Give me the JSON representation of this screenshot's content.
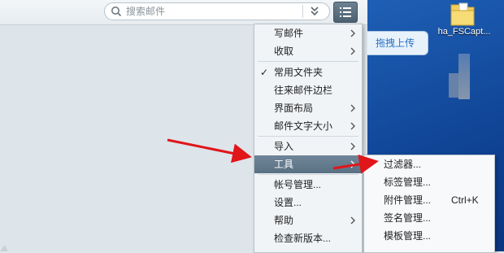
{
  "search": {
    "placeholder": "搜索邮件"
  },
  "menu": {
    "items": [
      {
        "label": "写邮件",
        "submenu": true,
        "checked": false,
        "active": false
      },
      {
        "label": "收取",
        "submenu": true,
        "checked": false,
        "active": false
      },
      {
        "label": "常用文件夹",
        "submenu": false,
        "checked": true,
        "active": false
      },
      {
        "label": "往来邮件边栏",
        "submenu": false,
        "checked": false,
        "active": false
      },
      {
        "label": "界面布局",
        "submenu": true,
        "checked": false,
        "active": false
      },
      {
        "label": "邮件文字大小",
        "submenu": true,
        "checked": false,
        "active": false
      },
      {
        "label": "导入",
        "submenu": true,
        "checked": false,
        "active": false
      },
      {
        "label": "工具",
        "submenu": true,
        "checked": false,
        "active": true
      },
      {
        "label": "帐号管理...",
        "submenu": false,
        "checked": false,
        "active": false
      },
      {
        "label": "设置...",
        "submenu": false,
        "checked": false,
        "active": false
      },
      {
        "label": "帮助",
        "submenu": true,
        "checked": false,
        "active": false
      },
      {
        "label": "检查新版本...",
        "submenu": false,
        "checked": false,
        "active": false
      }
    ]
  },
  "submenu": {
    "items": [
      {
        "label": "过滤器...",
        "shortcut": ""
      },
      {
        "label": "标签管理...",
        "shortcut": ""
      },
      {
        "label": "附件管理...",
        "shortcut": "Ctrl+K"
      },
      {
        "label": "签名管理...",
        "shortcut": ""
      },
      {
        "label": "模板管理...",
        "shortcut": ""
      }
    ]
  },
  "desktop": {
    "drag_upload_label": "拖拽上传",
    "folder_label": "ha_FSCapt..."
  },
  "colors": {
    "accent": "#5a7083",
    "desktop": "#1e5fb5",
    "arrow": "#e0161a"
  }
}
